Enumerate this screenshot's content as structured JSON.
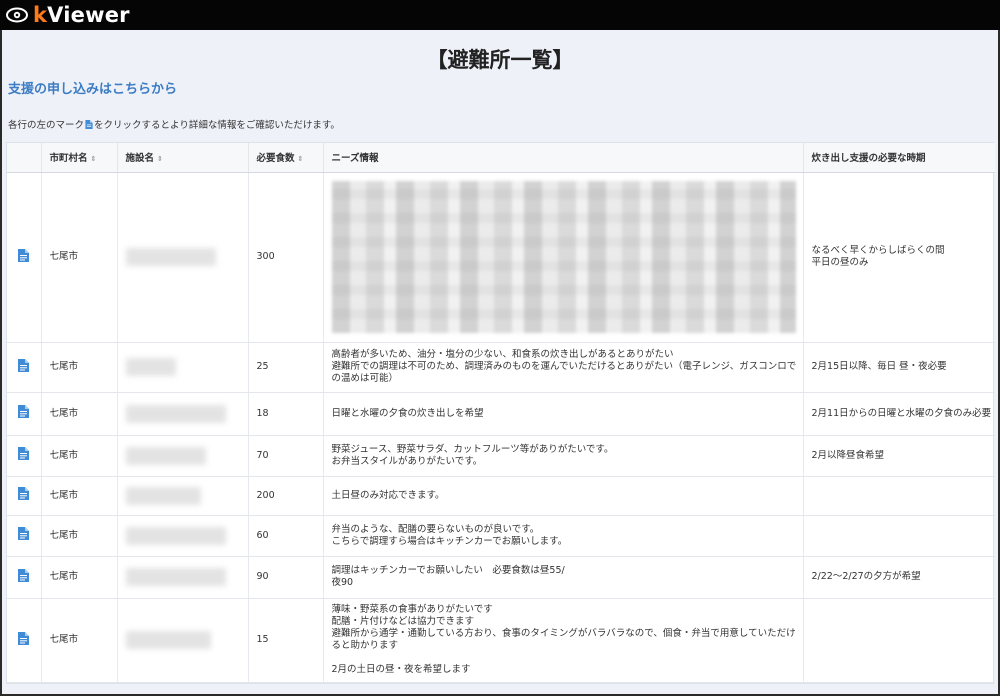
{
  "app": {
    "logo_k": "k",
    "logo_rest": "Viewer"
  },
  "page": {
    "title": "【避難所一覧】",
    "support_link": "支援の申し込みはこちらから",
    "instruction_before": "各行の左のマーク",
    "instruction_after": "をクリックするとより詳細な情報をご確認いただけます。"
  },
  "table": {
    "headers": {
      "city": "市町村名",
      "facility": "施設名",
      "meals": "必要食数",
      "needs": "ニーズ情報",
      "timing": "炊き出し支援の必要な時期"
    },
    "rows": [
      {
        "city": "七尾市",
        "meals": "300",
        "needs": "",
        "timing": "なるべく早くからしばらくの間\n平日の昼のみ"
      },
      {
        "city": "七尾市",
        "meals": "25",
        "needs": "高齢者が多いため、油分・塩分の少ない、和食系の炊き出しがあるとありがたい\n避難所での調理は不可のため、調理済みのものを運んでいただけるとありがたい（電子レンジ、ガスコンロでの温めは可能）",
        "timing": "2月15日以降、毎日 昼・夜必要"
      },
      {
        "city": "七尾市",
        "meals": "18",
        "needs": "日曜と水曜の夕食の炊き出しを希望",
        "timing": "2月11日からの日曜と水曜の夕食のみ必要"
      },
      {
        "city": "七尾市",
        "meals": "70",
        "needs": "野菜ジュース、野菜サラダ、カットフルーツ等がありがたいです。\nお弁当スタイルがありがたいです。",
        "timing": "2月以降昼食希望"
      },
      {
        "city": "七尾市",
        "meals": "200",
        "needs": "土日昼のみ対応できます。",
        "timing": ""
      },
      {
        "city": "七尾市",
        "meals": "60",
        "needs": "弁当のような、配膳の要らないものが良いです。\nこちらで調理すら場合はキッチンカーでお願いします。",
        "timing": ""
      },
      {
        "city": "七尾市",
        "meals": "90",
        "needs": "調理はキッチンカーでお願いしたい　必要食数は昼55/\n夜90",
        "timing": "2/22～2/27の夕方が希望"
      },
      {
        "city": "七尾市",
        "meals": "15",
        "needs": "薄味・野菜系の食事がありがたいです\n配膳・片付けなどは協力できます\n避難所から通学・通勤している方おり、食事のタイミングがバラバラなので、個食・弁当で用意していただけると助かります\n\n2月の土日の昼・夜を希望します",
        "timing": ""
      }
    ]
  },
  "colors": {
    "accent": "#3b7cc4",
    "logo_orange": "#ff7a1a",
    "topbar": "#050505"
  },
  "icons": {
    "row_detail": "document-icon",
    "sort": "sort-icon",
    "logo": "eye-icon"
  }
}
